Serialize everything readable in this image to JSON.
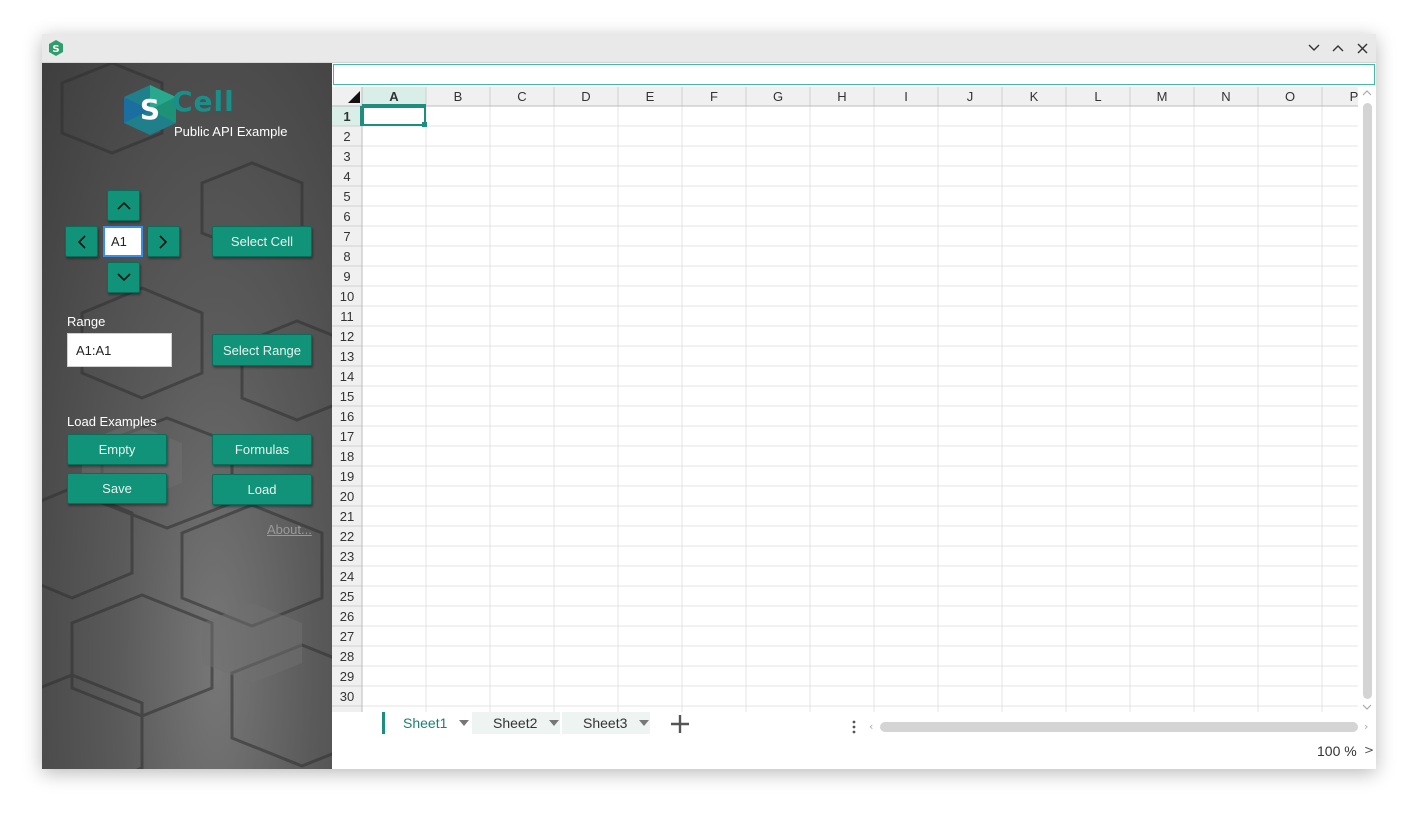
{
  "window": {
    "title": "",
    "controls": [
      "minimize",
      "maximize",
      "close"
    ]
  },
  "sidebar": {
    "logo_text": "Cell",
    "subtitle": "Public API Example",
    "cell_input_value": "A1",
    "select_cell_label": "Select Cell",
    "range_label": "Range",
    "range_input_value": "A1:A1",
    "select_range_label": "Select Range",
    "load_examples_label": "Load Examples",
    "buttons": {
      "empty": "Empty",
      "formulas": "Formulas",
      "save": "Save",
      "load": "Load"
    },
    "about_link": "About..."
  },
  "formula_bar": {
    "value": ""
  },
  "grid": {
    "columns": [
      "A",
      "B",
      "C",
      "D",
      "E",
      "F",
      "G",
      "H",
      "I",
      "J",
      "K",
      "L",
      "M",
      "N",
      "O",
      "P"
    ],
    "rows": [
      "1",
      "2",
      "3",
      "4",
      "5",
      "6",
      "7",
      "8",
      "9",
      "10",
      "11",
      "12",
      "13",
      "14",
      "15",
      "16",
      "17",
      "18",
      "19",
      "20",
      "21",
      "22",
      "23",
      "24",
      "25",
      "26",
      "27",
      "28",
      "29",
      "30"
    ],
    "selected_cell": "A1",
    "accent_color": "#1e8c7e",
    "header_bg": "#f0f0f0",
    "selected_header_bg": "#d9eee7"
  },
  "sheets": {
    "tabs": [
      {
        "label": "Sheet1",
        "active": true
      },
      {
        "label": "Sheet2",
        "active": false
      },
      {
        "label": "Sheet3",
        "active": false
      }
    ]
  },
  "status": {
    "zoom": "100 %"
  }
}
